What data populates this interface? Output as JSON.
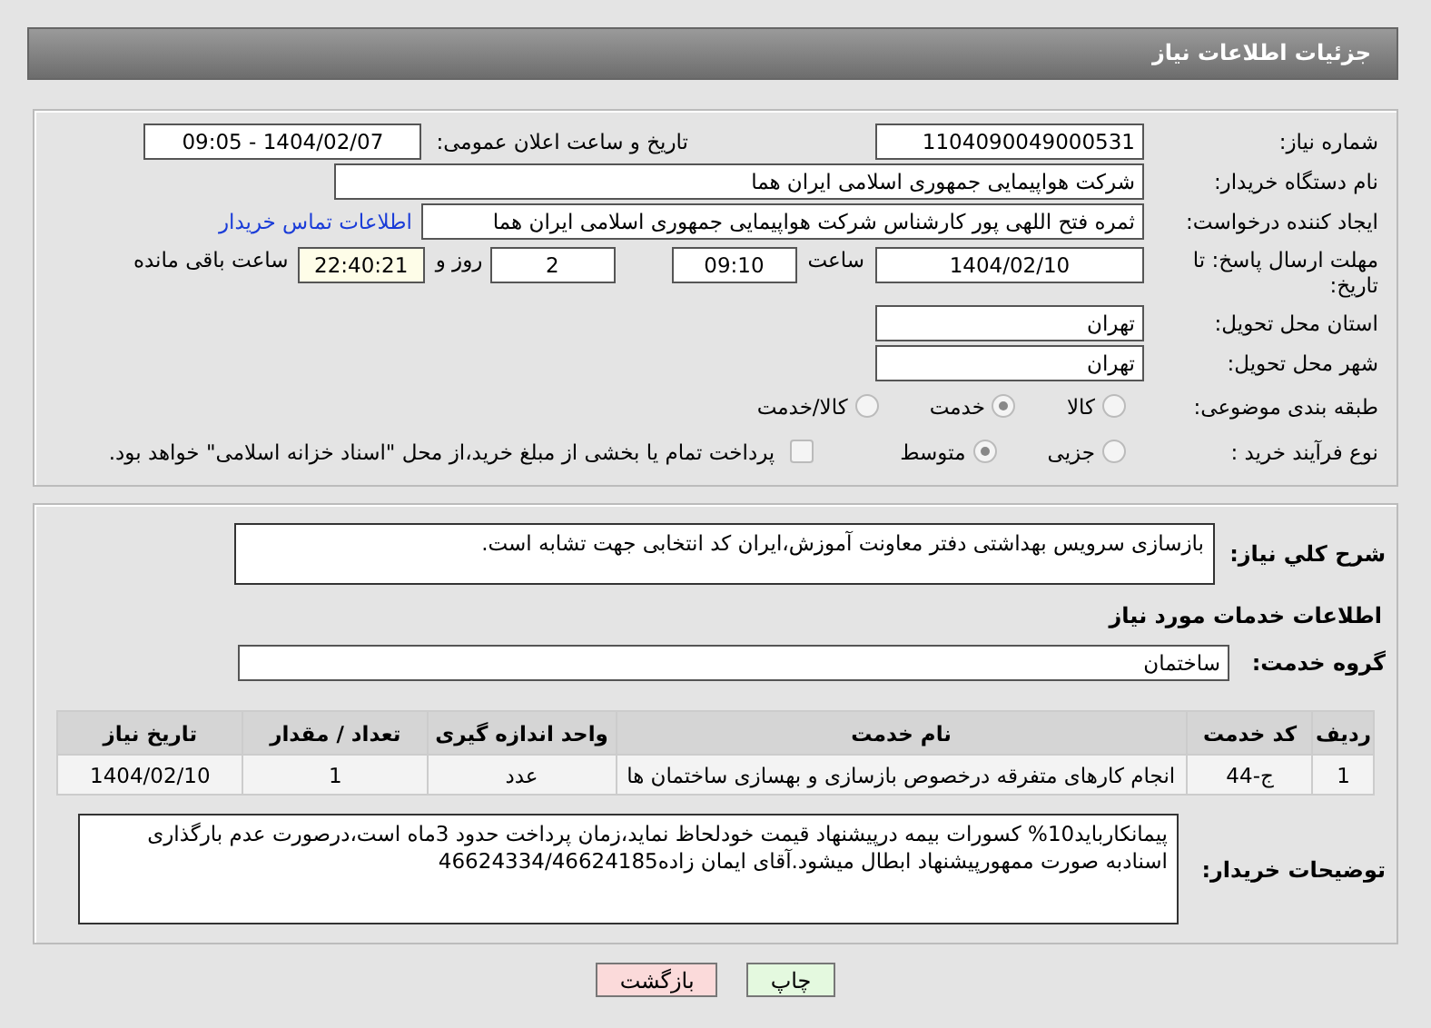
{
  "header": {
    "title": "جزئیات اطلاعات نیاز"
  },
  "need_number": {
    "label": "شماره نیاز:",
    "value": "1104090049000531"
  },
  "announce_datetime": {
    "label": "تاریخ و ساعت اعلان عمومی:",
    "value": "1404/02/07 - 09:05"
  },
  "buyer_org": {
    "label": "نام دستگاه خریدار:",
    "value": "شرکت هواپیمایی جمهوری اسلامی ایران هما"
  },
  "requester": {
    "label": "ایجاد کننده درخواست:",
    "value": "ثمره فتح اللهی پور کارشناس شرکت هواپیمایی جمهوری اسلامی ایران هما",
    "contact_link": "اطلاعات تماس خریدار"
  },
  "deadline": {
    "label": "مهلت ارسال پاسخ: تا تاریخ:",
    "date": "1404/02/10",
    "time_label": "ساعت",
    "time": "09:10",
    "days": "2",
    "days_label": "روز و",
    "remaining": "22:40:21",
    "remaining_label": "ساعت باقی مانده"
  },
  "province": {
    "label": "استان محل تحویل:",
    "value": "تهران"
  },
  "city": {
    "label": "شهر محل تحویل:",
    "value": "تهران"
  },
  "subject_category": {
    "label": "طبقه بندی موضوعی:",
    "options": [
      {
        "label": "کالا",
        "selected": false
      },
      {
        "label": "خدمت",
        "selected": true
      },
      {
        "label": "کالا/خدمت",
        "selected": false
      }
    ]
  },
  "purchase_process": {
    "label": "نوع فرآیند خرید :",
    "options": [
      {
        "label": "جزیی",
        "selected": false
      },
      {
        "label": "متوسط",
        "selected": true
      }
    ],
    "payment_checkbox": {
      "label": "پرداخت تمام یا بخشی از مبلغ خرید،از محل \"اسناد خزانه اسلامی\" خواهد بود.",
      "checked": false
    }
  },
  "description": {
    "label": "شرح کلي نياز:",
    "value": "بازسازی سرویس بهداشتی دفتر معاونت آموزش،ایران کد انتخابی جهت تشابه است."
  },
  "services_heading": "اطلاعات خدمات مورد نیاز",
  "service_group": {
    "label": "گروه خدمت:",
    "value": "ساختمان"
  },
  "table": {
    "columns": [
      "ردیف",
      "کد خدمت",
      "نام خدمت",
      "واحد اندازه گیری",
      "تعداد / مقدار",
      "تاریخ نیاز"
    ],
    "rows": [
      [
        "1",
        "ج-44",
        "انجام کارهای متفرقه درخصوص بازسازی و بهسازی ساختمان ها",
        "عدد",
        "1",
        "1404/02/10"
      ]
    ]
  },
  "buyer_notes": {
    "label": "توضیحات خریدار:",
    "value": "پیمانکارباید10% کسورات بیمه درپیشنهاد قیمت خودلحاظ نماید،زمان پرداخت حدود 3ماه است،درصورت عدم بارگذاری اسنادبه صورت ممهورپیشنهاد ابطال میشود.آقای ایمان زاده46624334/46624185"
  },
  "buttons": [
    {
      "label": "چاپ",
      "kind": "print"
    },
    {
      "label": "بازگشت",
      "kind": "back"
    }
  ]
}
